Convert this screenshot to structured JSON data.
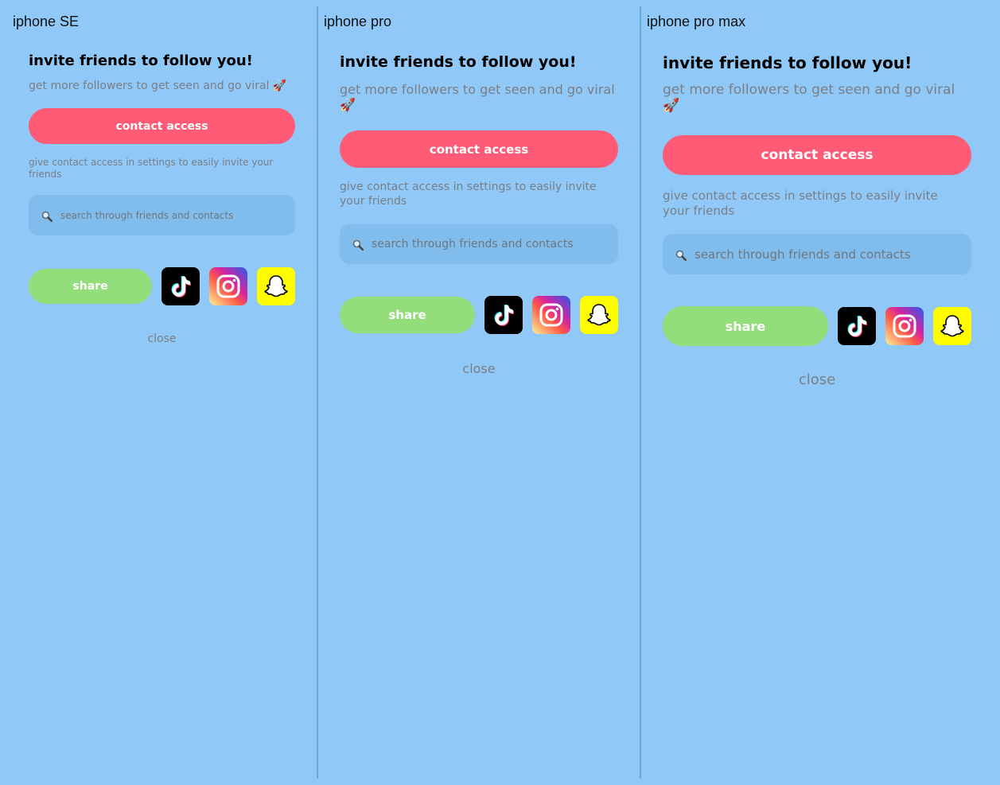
{
  "page": {
    "background": "#90c9f7"
  },
  "colors": {
    "contact_button": "#ff5a76",
    "share_button": "#94dd7b",
    "search_box": "#80bdec",
    "muted_text": "#7a7f86"
  },
  "panels": [
    {
      "device_label": "iphone SE",
      "title": "invite friends to follow you!",
      "subtitle": "get more followers to get seen and go viral 🚀",
      "contact_button_label": "contact access",
      "hint": "give contact access in settings to easily invite your friends",
      "search": {
        "icon": "search-icon",
        "placeholder": "search through friends and contacts"
      },
      "share_button_label": "share",
      "social_icons": [
        "tiktok-icon",
        "instagram-icon",
        "snapchat-icon"
      ],
      "close_label": "close"
    },
    {
      "device_label": "iphone pro",
      "title": "invite friends to follow you!",
      "subtitle": "get more followers to get seen and go viral 🚀",
      "contact_button_label": "contact access",
      "hint": "give contact access in settings to easily invite your friends",
      "search": {
        "icon": "search-icon",
        "placeholder": "search through friends and contacts"
      },
      "share_button_label": "share",
      "social_icons": [
        "tiktok-icon",
        "instagram-icon",
        "snapchat-icon"
      ],
      "close_label": "close"
    },
    {
      "device_label": "iphone pro max",
      "title": "invite friends to follow you!",
      "subtitle": "get more followers to get seen and go viral 🚀",
      "contact_button_label": "contact access",
      "hint": "give contact access in settings to easily invite your friends",
      "search": {
        "icon": "search-icon",
        "placeholder": "search through friends and contacts"
      },
      "share_button_label": "share",
      "social_icons": [
        "tiktok-icon",
        "instagram-icon",
        "snapchat-icon"
      ],
      "close_label": "close"
    }
  ]
}
